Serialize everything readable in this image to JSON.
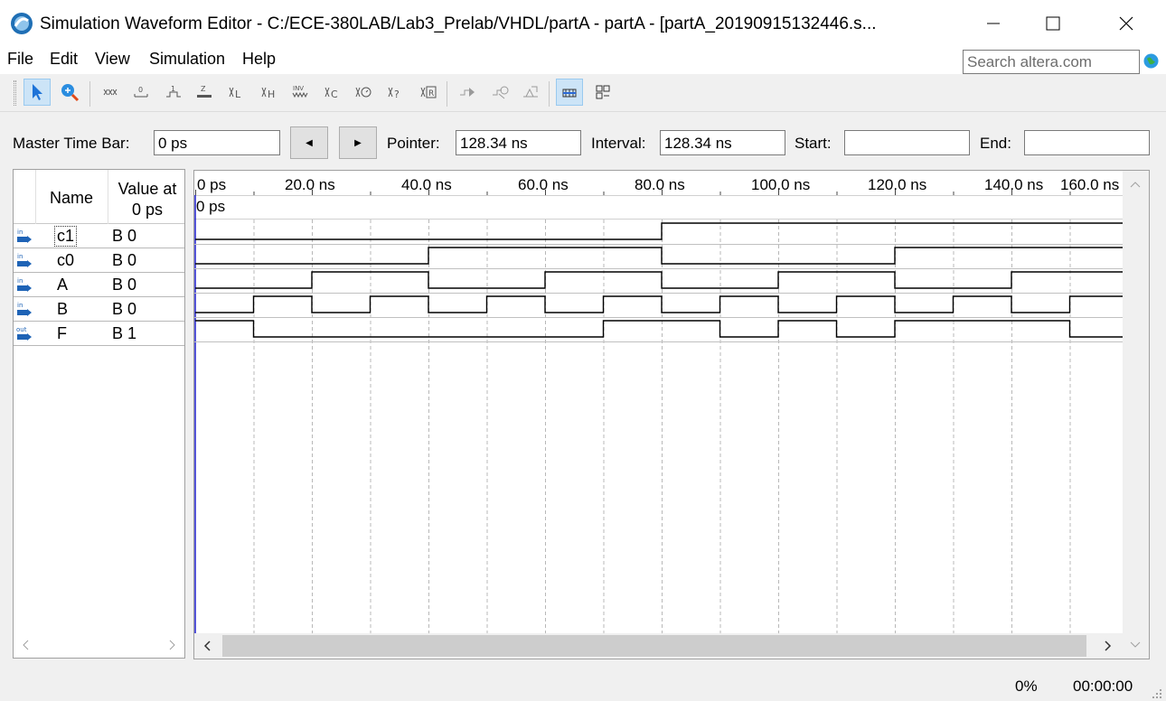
{
  "window": {
    "title": "Simulation Waveform Editor - C:/ECE-380LAB/Lab3_Prelab/VHDL/partA - partA - [partA_20190915132446.s..."
  },
  "menu": [
    "File",
    "Edit",
    "View",
    "Simulation",
    "Help"
  ],
  "search": {
    "placeholder": "Search altera.com"
  },
  "timebar": {
    "master_label": "Master Time Bar:",
    "master_value": "0 ps",
    "pointer_label": "Pointer:",
    "pointer_value": "128.34 ns",
    "interval_label": "Interval:",
    "interval_value": "128.34 ns",
    "start_label": "Start:",
    "start_value": "",
    "end_label": "End:",
    "end_value": ""
  },
  "columns": {
    "name": "Name",
    "value_line1": "Value at",
    "value_line2": "0 ps"
  },
  "signals": [
    {
      "type": "in",
      "name": "c1",
      "value": "B 0"
    },
    {
      "type": "in",
      "name": "c0",
      "value": "B 0"
    },
    {
      "type": "in",
      "name": "A",
      "value": "B 0"
    },
    {
      "type": "in",
      "name": "B",
      "value": "B 0"
    },
    {
      "type": "out",
      "name": "F",
      "value": "B 1"
    }
  ],
  "ruler": {
    "labels": [
      "0 ps",
      "20.0 ns",
      "40.0 ns",
      "60.0 ns",
      "80.0 ns",
      "100.0 ns",
      "120.0 ns",
      "140.0 ns",
      "160.0 ns"
    ],
    "marker_label": "0 ps"
  },
  "waveforms": {
    "unit": "ns",
    "t_end": 160,
    "c1": [
      [
        0,
        0
      ],
      [
        80,
        1
      ]
    ],
    "c0": [
      [
        0,
        0
      ],
      [
        40,
        1
      ],
      [
        80,
        0
      ],
      [
        120,
        1
      ]
    ],
    "A": [
      [
        0,
        0
      ],
      [
        20,
        1
      ],
      [
        40,
        0
      ],
      [
        60,
        1
      ],
      [
        80,
        0
      ],
      [
        100,
        1
      ],
      [
        120,
        0
      ],
      [
        140,
        1
      ]
    ],
    "B": [
      [
        0,
        0
      ],
      [
        10,
        1
      ],
      [
        20,
        0
      ],
      [
        30,
        1
      ],
      [
        40,
        0
      ],
      [
        50,
        1
      ],
      [
        60,
        0
      ],
      [
        70,
        1
      ],
      [
        80,
        0
      ],
      [
        90,
        1
      ],
      [
        100,
        0
      ],
      [
        110,
        1
      ],
      [
        120,
        0
      ],
      [
        130,
        1
      ],
      [
        140,
        0
      ],
      [
        150,
        1
      ]
    ],
    "F": [
      [
        0,
        1
      ],
      [
        10,
        0
      ],
      [
        70,
        1
      ],
      [
        90,
        0
      ],
      [
        100,
        1
      ],
      [
        110,
        0
      ],
      [
        120,
        1
      ],
      [
        150,
        0
      ]
    ]
  },
  "status": {
    "progress": "0%",
    "time": "00:00:00"
  },
  "icons": {
    "toolbar": [
      "pointer-tool-icon",
      "zoom-tool-icon",
      "uninitialized-icon",
      "forcing-low-icon",
      "forcing-high-icon",
      "high-impedance-icon",
      "weak-low-icon",
      "weak-high-icon",
      "invert-icon",
      "count-value-icon",
      "clock-icon",
      "random-value-icon",
      "arbitrary-value-icon",
      "run-functional-icon",
      "run-timing-icon",
      "generate-netlist-icon",
      "snap-to-grid-icon",
      "sort-icon"
    ]
  }
}
